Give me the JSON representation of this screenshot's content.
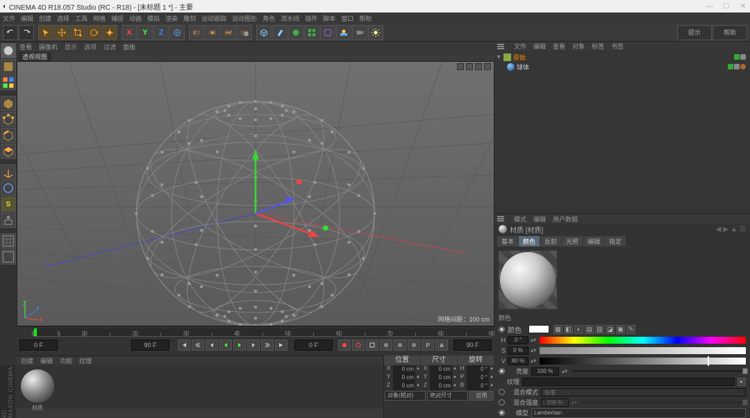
{
  "title": "CINEMA 4D R18.057 Studio (RC - R18) - [未标题 1 *] - 主要",
  "menu": [
    "文件",
    "编辑",
    "创建",
    "选择",
    "工具",
    "网格",
    "捕捉",
    "动画",
    "模拟",
    "渲染",
    "雕刻",
    "运动跟踪",
    "运动图形",
    "角色",
    "流水线",
    "插件",
    "脚本",
    "窗口",
    "帮助"
  ],
  "vp_menu": [
    "查看",
    "摄像机",
    "显示",
    "选项",
    "过滤",
    "面板"
  ],
  "vp_tab": "透视视图",
  "vp_status": "网格间距：100 cm",
  "timeline": {
    "start": "0 F",
    "end": "90 F",
    "cur": "0 F",
    "max": "90 F"
  },
  "ticks": [
    0,
    5,
    10,
    15,
    20,
    25,
    30,
    35,
    40,
    45,
    50,
    55,
    60,
    65,
    70,
    75,
    80,
    85,
    90
  ],
  "mat_tabs": [
    "创建",
    "编辑",
    "功能",
    "纹理"
  ],
  "mat_name": "材质",
  "objtop": [
    "文件",
    "编辑",
    "查看",
    "对象",
    "标签",
    "书签"
  ],
  "tree": {
    "root": "原始",
    "child": "球体"
  },
  "attr_menu": [
    "模式",
    "编辑",
    "用户数据"
  ],
  "attr_title": "材质 [材质]",
  "attr_tabs": [
    "基本",
    "颜色",
    "反射",
    "光照",
    "编辑",
    "指定"
  ],
  "attr_active": 1,
  "section": "颜色",
  "color_label": "颜色",
  "picker_icons": [
    "▦",
    "◧",
    "◐",
    "▤",
    "▥",
    "◪",
    "▣",
    "✎"
  ],
  "hsv": {
    "h": {
      "label": "H",
      "val": "0 °"
    },
    "s": {
      "label": "S",
      "val": "0 %"
    },
    "v": {
      "label": "V",
      "val": "80 %"
    }
  },
  "brightness": {
    "label": "亮度",
    "val": "100 %"
  },
  "texture": {
    "label": "纹理"
  },
  "mix_mode": {
    "label": "混合模式",
    "val": "标准"
  },
  "mix_strength": {
    "label": "混合强度",
    "val": "100 %"
  },
  "model_label": "模型",
  "lambert": "Lambertian",
  "coord": {
    "headers": [
      "位置",
      "尺寸",
      "旋转"
    ],
    "rows": [
      {
        "a": "X",
        "v": "0 cm",
        "b": "X",
        "v2": "0 cm",
        "c": "H",
        "v3": "0 °"
      },
      {
        "a": "Y",
        "v": "0 cm",
        "b": "Y",
        "v2": "0 cm",
        "c": "P",
        "v3": "0 °"
      },
      {
        "a": "Z",
        "v": "0 cm",
        "b": "Z",
        "v2": "0 cm",
        "c": "B",
        "v3": "0 °"
      }
    ],
    "dd1": "对象(相对)",
    "dd2": "绝对尺寸",
    "apply": "应用"
  },
  "help_left": "提示",
  "help_right": "帮助"
}
